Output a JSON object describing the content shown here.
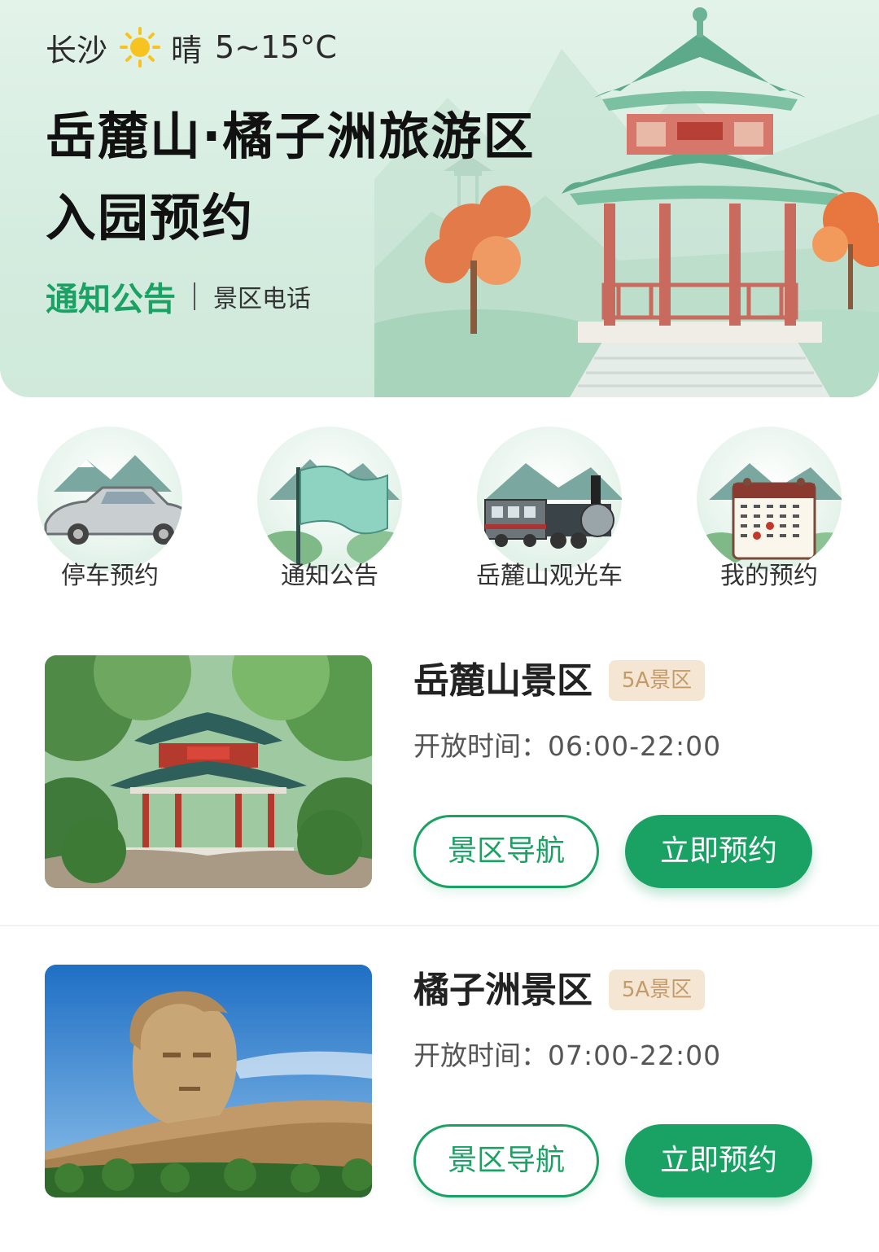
{
  "header": {
    "city": "长沙",
    "weather_icon": "sun-icon",
    "condition": "晴",
    "temperature": "5~15°C",
    "title_line1": "岳麓山·橘子洲旅游区",
    "title_line2": "入园预约",
    "links": [
      {
        "label": "通知公告",
        "active": true
      },
      {
        "label": "景区电话",
        "active": false
      }
    ]
  },
  "quick_entries": [
    {
      "label": "停车预约",
      "icon": "car-icon"
    },
    {
      "label": "通知公告",
      "icon": "flag-icon"
    },
    {
      "label": "岳麓山观光车",
      "icon": "train-icon"
    },
    {
      "label": "我的预约",
      "icon": "calendar-icon"
    }
  ],
  "scenic_spots": [
    {
      "name": "岳麓山景区",
      "badge": "5A景区",
      "hours_label": "开放时间：",
      "hours": "06:00-22:00",
      "nav_label": "景区导航",
      "book_label": "立即预约"
    },
    {
      "name": "橘子洲景区",
      "badge": "5A景区",
      "hours_label": "开放时间：",
      "hours": "07:00-22:00",
      "nav_label": "景区导航",
      "book_label": "立即预约"
    }
  ],
  "colors": {
    "accent": "#1aa265",
    "badge_bg": "#f5e6d3",
    "badge_text": "#c49a68",
    "hero_bg": "#d4ecdf"
  }
}
